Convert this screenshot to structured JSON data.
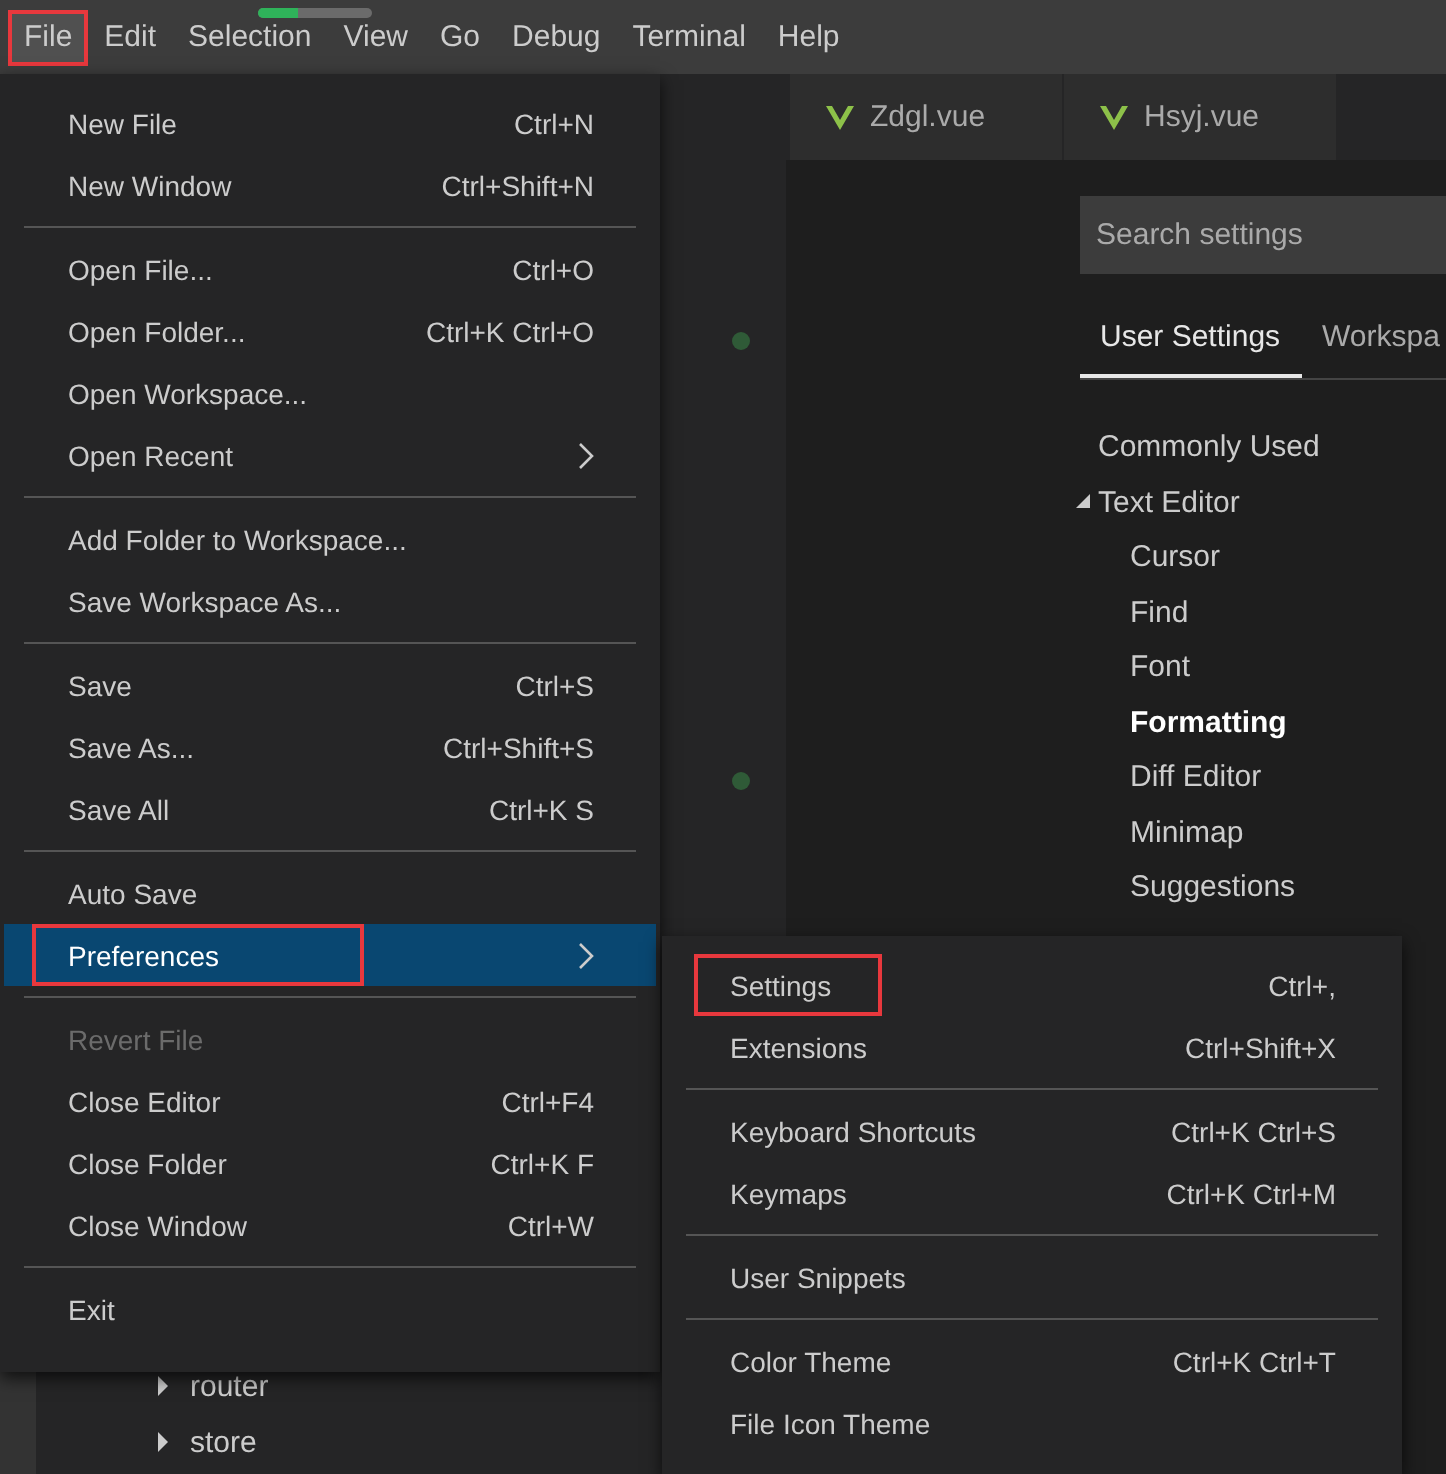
{
  "menu_bar": [
    {
      "label": "File",
      "open": true,
      "highlighted": true
    },
    {
      "label": "Edit",
      "open": false,
      "highlighted": false
    },
    {
      "label": "Selection",
      "open": false,
      "highlighted": false
    },
    {
      "label": "View",
      "open": false,
      "highlighted": false
    },
    {
      "label": "Go",
      "open": false,
      "highlighted": false
    },
    {
      "label": "Debug",
      "open": false,
      "highlighted": false
    },
    {
      "label": "Terminal",
      "open": false,
      "highlighted": false
    },
    {
      "label": "Help",
      "open": false,
      "highlighted": false
    }
  ],
  "progress": {
    "level": 0.35
  },
  "editor_tabs": [
    {
      "label": "Zdgl.vue"
    },
    {
      "label": "Hsyj.vue"
    }
  ],
  "explorer": {
    "items": [
      {
        "label": "router",
        "expanded": false
      },
      {
        "label": "store",
        "expanded": false
      }
    ]
  },
  "settings": {
    "search": {
      "placeholder": "Search settings"
    },
    "tabs": [
      {
        "label": "User Settings",
        "selected": true
      },
      {
        "label": "Workspa",
        "selected": false
      }
    ],
    "tree": [
      {
        "label": "Commonly Used",
        "selected": false
      },
      {
        "label": "Text Editor",
        "selected": false,
        "expanded": true,
        "children": [
          {
            "label": "Cursor",
            "selected": false
          },
          {
            "label": "Find",
            "selected": false
          },
          {
            "label": "Font",
            "selected": false
          },
          {
            "label": "Formatting",
            "selected": true
          },
          {
            "label": "Diff Editor",
            "selected": false
          },
          {
            "label": "Minimap",
            "selected": false
          },
          {
            "label": "Suggestions",
            "selected": false
          }
        ]
      }
    ]
  },
  "file_menu": {
    "items": [
      {
        "kind": "item",
        "label": "New File",
        "shortcut": "Ctrl+N",
        "submenu": false,
        "selected": false,
        "disabled": false,
        "highlighted": false
      },
      {
        "kind": "item",
        "label": "New Window",
        "shortcut": "Ctrl+Shift+N",
        "submenu": false,
        "selected": false,
        "disabled": false,
        "highlighted": false
      },
      {
        "kind": "separator"
      },
      {
        "kind": "item",
        "label": "Open File...",
        "shortcut": "Ctrl+O",
        "submenu": false,
        "selected": false,
        "disabled": false,
        "highlighted": false
      },
      {
        "kind": "item",
        "label": "Open Folder...",
        "shortcut": "Ctrl+K Ctrl+O",
        "submenu": false,
        "selected": false,
        "disabled": false,
        "highlighted": false
      },
      {
        "kind": "item",
        "label": "Open Workspace...",
        "submenu": false,
        "selected": false,
        "disabled": false,
        "highlighted": false
      },
      {
        "kind": "item",
        "label": "Open Recent",
        "submenu": true,
        "selected": false,
        "disabled": false,
        "highlighted": false
      },
      {
        "kind": "separator"
      },
      {
        "kind": "item",
        "label": "Add Folder to Workspace...",
        "submenu": false,
        "selected": false,
        "disabled": false,
        "highlighted": false
      },
      {
        "kind": "item",
        "label": "Save Workspace As...",
        "submenu": false,
        "selected": false,
        "disabled": false,
        "highlighted": false
      },
      {
        "kind": "separator"
      },
      {
        "kind": "item",
        "label": "Save",
        "shortcut": "Ctrl+S",
        "submenu": false,
        "selected": false,
        "disabled": false,
        "highlighted": false
      },
      {
        "kind": "item",
        "label": "Save As...",
        "shortcut": "Ctrl+Shift+S",
        "submenu": false,
        "selected": false,
        "disabled": false,
        "highlighted": false
      },
      {
        "kind": "item",
        "label": "Save All",
        "shortcut": "Ctrl+K S",
        "submenu": false,
        "selected": false,
        "disabled": false,
        "highlighted": false
      },
      {
        "kind": "separator"
      },
      {
        "kind": "item",
        "label": "Auto Save",
        "submenu": false,
        "selected": false,
        "disabled": false,
        "highlighted": false
      },
      {
        "kind": "item",
        "label": "Preferences",
        "submenu": true,
        "selected": true,
        "disabled": false,
        "highlighted": true
      },
      {
        "kind": "separator"
      },
      {
        "kind": "item",
        "label": "Revert File",
        "submenu": false,
        "selected": false,
        "disabled": true,
        "highlighted": false
      },
      {
        "kind": "item",
        "label": "Close Editor",
        "shortcut": "Ctrl+F4",
        "submenu": false,
        "selected": false,
        "disabled": false,
        "highlighted": false
      },
      {
        "kind": "item",
        "label": "Close Folder",
        "shortcut": "Ctrl+K F",
        "submenu": false,
        "selected": false,
        "disabled": false,
        "highlighted": false
      },
      {
        "kind": "item",
        "label": "Close Window",
        "shortcut": "Ctrl+W",
        "submenu": false,
        "selected": false,
        "disabled": false,
        "highlighted": false
      },
      {
        "kind": "separator"
      },
      {
        "kind": "item",
        "label": "Exit",
        "submenu": false,
        "selected": false,
        "disabled": false,
        "highlighted": false
      }
    ]
  },
  "preferences_menu": {
    "items": [
      {
        "kind": "item",
        "label": "Settings",
        "shortcut": "Ctrl+,",
        "submenu": false,
        "selected": false,
        "disabled": false,
        "highlighted": true
      },
      {
        "kind": "item",
        "label": "Extensions",
        "shortcut": "Ctrl+Shift+X",
        "submenu": false,
        "selected": false,
        "disabled": false,
        "highlighted": false
      },
      {
        "kind": "separator"
      },
      {
        "kind": "item",
        "label": "Keyboard Shortcuts",
        "shortcut": "Ctrl+K Ctrl+S",
        "submenu": false,
        "selected": false,
        "disabled": false,
        "highlighted": false
      },
      {
        "kind": "item",
        "label": "Keymaps",
        "shortcut": "Ctrl+K Ctrl+M",
        "submenu": false,
        "selected": false,
        "disabled": false,
        "highlighted": false
      },
      {
        "kind": "separator"
      },
      {
        "kind": "item",
        "label": "User Snippets",
        "submenu": false,
        "selected": false,
        "disabled": false,
        "highlighted": false
      },
      {
        "kind": "separator"
      },
      {
        "kind": "item",
        "label": "Color Theme",
        "shortcut": "Ctrl+K Ctrl+T",
        "submenu": false,
        "selected": false,
        "disabled": false,
        "highlighted": false
      },
      {
        "kind": "item",
        "label": "File Icon Theme",
        "submenu": false,
        "selected": false,
        "disabled": false,
        "highlighted": false
      }
    ]
  }
}
